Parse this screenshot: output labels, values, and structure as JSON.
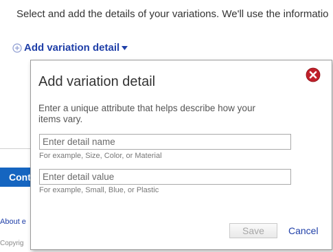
{
  "page": {
    "intro_text": "Select and add the details of your variations. We'll use the informatio",
    "add_link_label": "Add variation detail",
    "continue_label": "Cont",
    "about_link": "About e",
    "copyright": "Copyrig"
  },
  "dialog": {
    "title": "Add variation detail",
    "description": "Enter a unique attribute that helps describe how your items vary.",
    "name_field": {
      "value": "",
      "placeholder": "Enter detail name",
      "hint": "For example, Size, Color, or Material"
    },
    "value_field": {
      "value": "",
      "placeholder": "Enter detail value",
      "hint": "For example, Small, Blue, or Plastic"
    },
    "save_label": "Save",
    "cancel_label": "Cancel",
    "close_icon": "close-icon"
  },
  "colors": {
    "link": "#1f3fa8",
    "close": "#c0202a",
    "primary_button": "#1565c0"
  }
}
